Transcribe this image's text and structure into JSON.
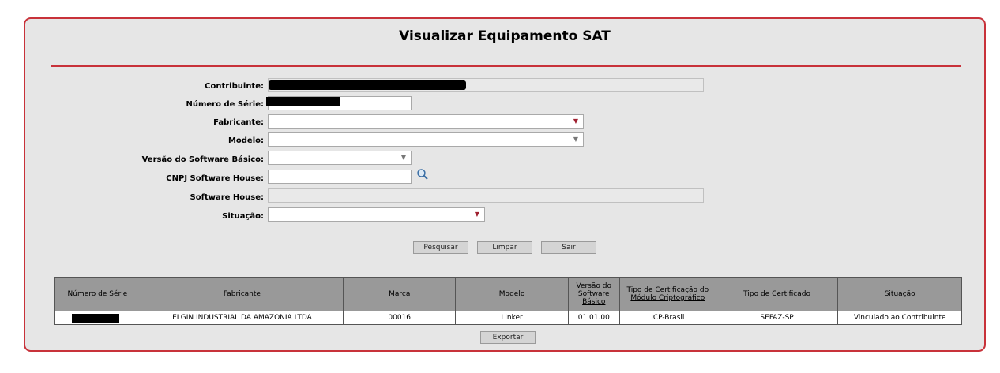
{
  "title": "Visualizar Equipamento SAT",
  "form": {
    "contribuinte_label": "Contribuinte:",
    "numero_serie_label": "Número de Série:",
    "fabricante_label": "Fabricante:",
    "modelo_label": "Modelo:",
    "versao_sb_label": "Versão do Software Básico:",
    "cnpj_sh_label": "CNPJ Software House:",
    "software_house_label": "Software House:",
    "situacao_label": "Situação:"
  },
  "buttons": {
    "pesquisar": "Pesquisar",
    "limpar": "Limpar",
    "sair": "Sair",
    "exportar": "Exportar"
  },
  "table": {
    "headers": [
      "Número de Série",
      "Fabricante",
      "Marca",
      "Modelo",
      "Versão do Software Básico",
      "Tipo de Certificação do Módulo Criptográfico",
      "Tipo de Certificado",
      "Situação"
    ],
    "rows": [
      {
        "numero_serie": "",
        "fabricante": "ELGIN INDUSTRIAL DA AMAZONIA LTDA",
        "marca": "00016",
        "modelo": "Linker",
        "versao": "01.01.00",
        "tipo_cert_modulo": "ICP-Brasil",
        "tipo_certificado": "SEFAZ-SP",
        "situacao": "Vinculado ao Contribuinte"
      }
    ]
  },
  "icons": {
    "search": "search-icon",
    "dropdown": "chevron-down-icon"
  },
  "colors": {
    "accent": "#c8323a",
    "panel_bg": "#e6e6e6",
    "header_bg": "#999999"
  }
}
